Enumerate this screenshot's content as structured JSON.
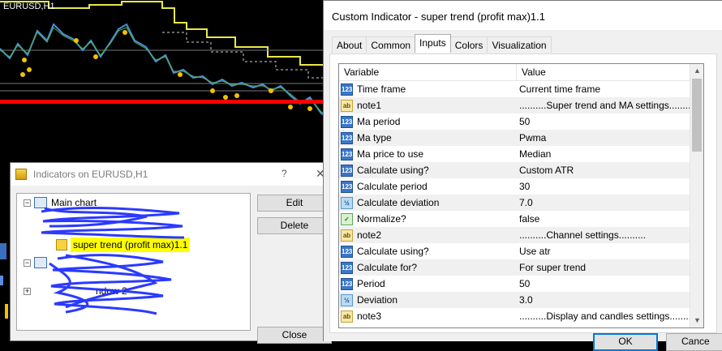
{
  "chart": {
    "symbol_label": "EURUSD,H1"
  },
  "indicators_dialog": {
    "title": "Indicators on EURUSD,H1",
    "help": "?",
    "close_x": "✕",
    "tree": {
      "main_chart": "Main chart",
      "indicator": "super trend (profit max)1.1",
      "window2": "ndow 2"
    },
    "buttons": {
      "edit": "Edit",
      "delete": "Delete",
      "close": "Close"
    }
  },
  "custom_dialog": {
    "title": "Custom Indicator - super trend (profit max)1.1",
    "tabs": [
      "About",
      "Common",
      "Inputs",
      "Colors",
      "Visualization"
    ],
    "active_tab": "Inputs",
    "grid": {
      "headers": [
        "Variable",
        "Value"
      ],
      "rows": [
        {
          "icon": "int-icon",
          "tag": "123",
          "variable": "Time frame",
          "value": "Current time frame"
        },
        {
          "icon": "string-icon",
          "tag": "ab",
          "variable": "note1",
          "value": "..........Super trend and MA settings.........."
        },
        {
          "icon": "int-icon",
          "tag": "123",
          "variable": "Ma period",
          "value": "50"
        },
        {
          "icon": "int-icon",
          "tag": "123",
          "variable": "Ma type",
          "value": "Pwma"
        },
        {
          "icon": "int-icon",
          "tag": "123",
          "variable": "Ma price to use",
          "value": "Median"
        },
        {
          "icon": "int-icon",
          "tag": "123",
          "variable": "Calculate using?",
          "value": "Custom ATR"
        },
        {
          "icon": "int-icon",
          "tag": "123",
          "variable": "Calculate period",
          "value": "30"
        },
        {
          "icon": "double-icon",
          "tag": "½",
          "variable": "Calculate deviation",
          "value": "7.0"
        },
        {
          "icon": "bool-icon",
          "tag": "✓",
          "variable": "Normalize?",
          "value": "false"
        },
        {
          "icon": "string-icon",
          "tag": "ab",
          "variable": "note2",
          "value": "..........Channel settings.........."
        },
        {
          "icon": "int-icon",
          "tag": "123",
          "variable": "Calculate using?",
          "value": "Use atr"
        },
        {
          "icon": "int-icon",
          "tag": "123",
          "variable": "Calculate for?",
          "value": "For super trend"
        },
        {
          "icon": "int-icon",
          "tag": "123",
          "variable": "Period",
          "value": "50"
        },
        {
          "icon": "double-icon",
          "tag": "½",
          "variable": "Deviation",
          "value": "3.0"
        },
        {
          "icon": "string-icon",
          "tag": "ab",
          "variable": "note3",
          "value": "..........Display and candles settings.........."
        }
      ]
    },
    "buttons": {
      "ok": "OK",
      "cancel": "Cance"
    }
  }
}
